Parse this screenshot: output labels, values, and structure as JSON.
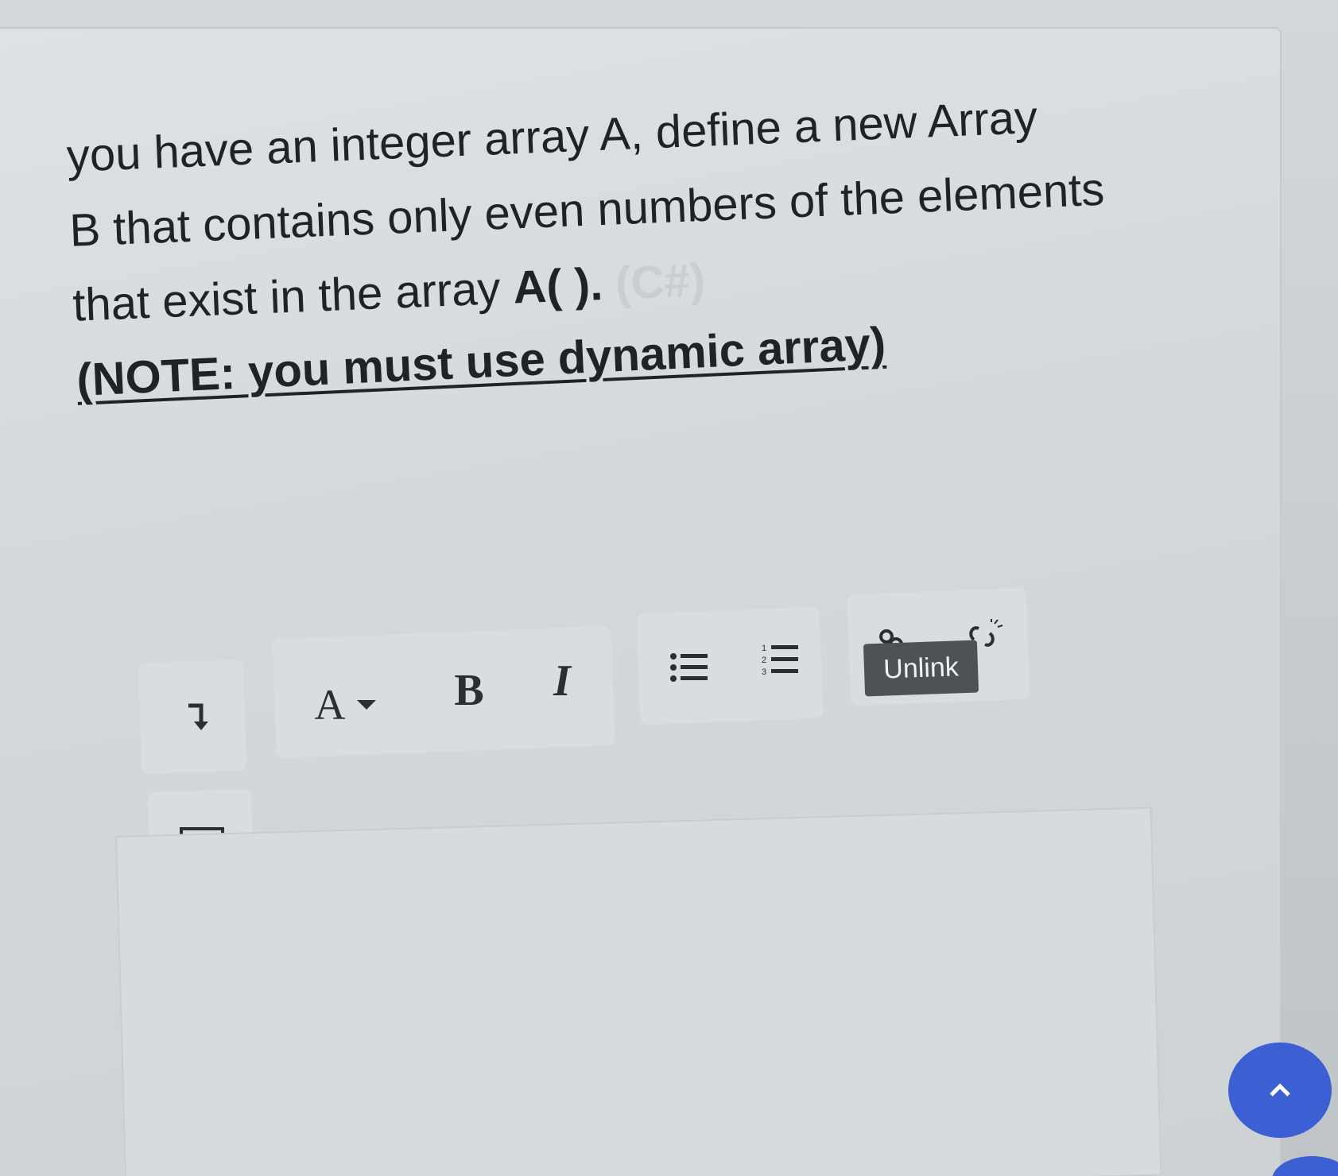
{
  "question": {
    "line1": "you have an integer array A, define a new Array",
    "line2": "B that contains only even numbers of the elements",
    "line3_text": "that exist in the array ",
    "line3_bold": "A( ).",
    "line3_faint": " (C#)",
    "note": "(NOTE: you must use dynamic array)"
  },
  "toolbar": {
    "indent_icon": "indent-arrow-icon",
    "font_color_label": "A",
    "bold_label": "B",
    "italic_label": "I",
    "bullet_list_icon": "bulleted-list-icon",
    "numbered_list_icon": "numbered-list-icon",
    "link_icon": "link-icon",
    "unlink_icon": "unlink-icon",
    "image_icon": "image-icon"
  },
  "tooltip": {
    "unlink": "Unlink"
  },
  "colors": {
    "accent": "#3d5fd4",
    "tooltip_bg": "#4e5256",
    "text": "#1f2326"
  }
}
